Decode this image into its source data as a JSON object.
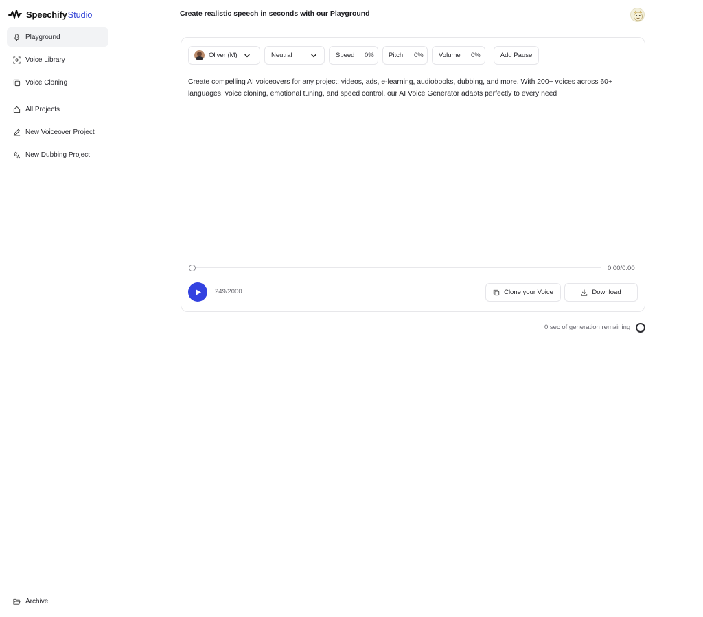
{
  "brand": {
    "name": "Speechify",
    "accent": "Studio",
    "accent_color": "#3b4bd8"
  },
  "sidebar": {
    "items": [
      {
        "label": "Playground",
        "icon": "microphone-icon",
        "active": true
      },
      {
        "label": "Voice Library",
        "icon": "voice-library-icon"
      },
      {
        "label": "Voice Cloning",
        "icon": "copy-icon"
      },
      {
        "label": "All Projects",
        "icon": "home-icon"
      },
      {
        "label": "New Voiceover Project",
        "icon": "pen-icon"
      },
      {
        "label": "New Dubbing Project",
        "icon": "translate-icon"
      }
    ],
    "archive": {
      "label": "Archive",
      "icon": "folder-open-icon"
    }
  },
  "header": {
    "title": "Create realistic speech in seconds with our Playground",
    "avatar_icon": "user-avatar-icon"
  },
  "controls": {
    "voice": {
      "label": "Oliver (M)",
      "icon": "voice-avatar-icon"
    },
    "emotion": {
      "label": "Neutral"
    },
    "speed": {
      "label": "Speed",
      "value": "0%"
    },
    "pitch": {
      "label": "Pitch",
      "value": "0%"
    },
    "volume": {
      "label": "Volume",
      "value": "0%"
    },
    "add_pause": {
      "label": "Add Pause"
    }
  },
  "editor": {
    "text": "Create compelling AI voiceovers for any project: videos, ads, e-learning, audiobooks, dubbing, and more. With 200+ voices across 60+ languages, voice cloning, emotional tuning, and speed control, our AI Voice Generator adapts perfectly to every need"
  },
  "player": {
    "time": "0:00/0:00",
    "char_count": "249/2000",
    "progress": 0,
    "play_color": "#3342e0"
  },
  "actions": {
    "clone_label": "Clone your Voice",
    "download_label": "Download"
  },
  "footer": {
    "remaining": "0 sec of generation remaining"
  }
}
